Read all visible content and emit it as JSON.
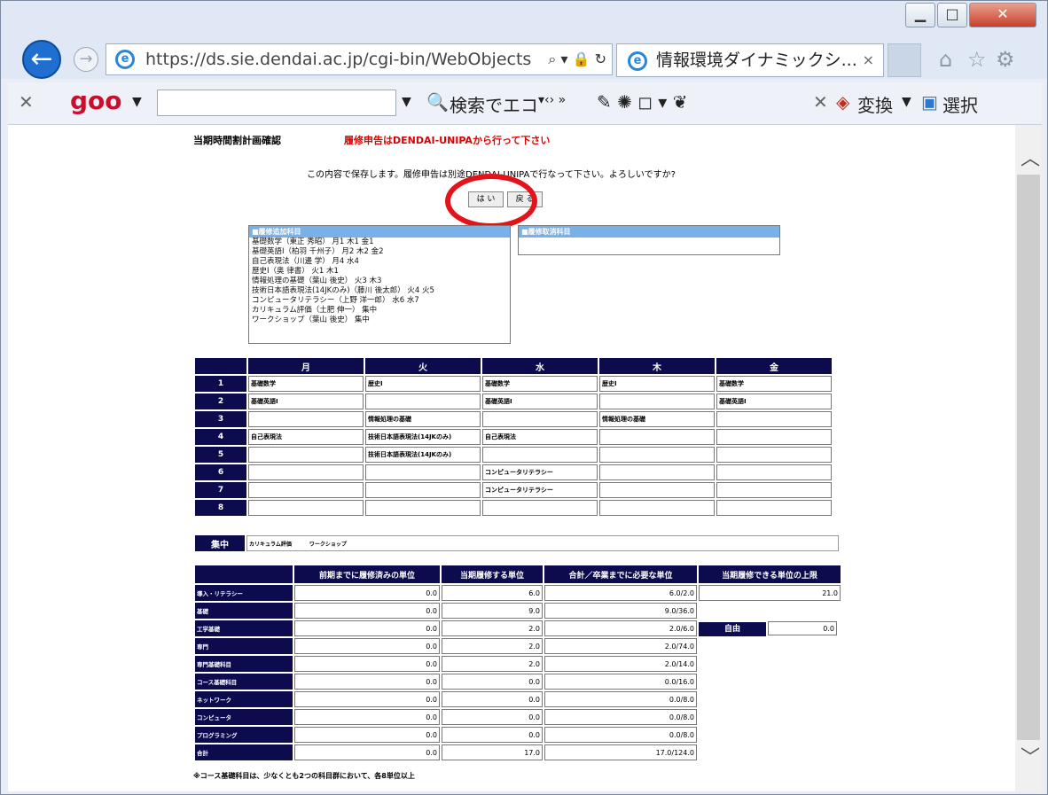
{
  "browser": {
    "url": "https://ds.sie.dendai.ac.jp/cgi-bin/WebObjects",
    "tab_title": "情報環境ダイナミックシ...",
    "toolbar": {
      "brand": "goo",
      "eco_search": "検索でエコ",
      "convert": "変換",
      "select": "選択"
    }
  },
  "page": {
    "title": "当期時間割計画確認",
    "notice": "履修申告はDENDAI-UNIPAから行って下さい",
    "confirm_message": "この内容で保存します。履修申告は別途DENDAI-UNIPAで行なって下さい。よろしいですか?",
    "yes_button": "は い",
    "cancel_button": "戻 る",
    "added_box": {
      "header": "■履修追加科目",
      "courses": [
        "基礎数学（東正 秀昭） 月1 木1 金1",
        "基礎英語Ⅰ（柏羽 千州子） 月2 木2 金2",
        "自己表現法（川邊 学） 月4 水4",
        "歴史Ⅰ（奥 律書） 火1 木1",
        "情報処理の基礎（葉山 後史） 火3 木3",
        "技術日本語表現法(14JKのみ)（藤川 後太郎） 火4 火5",
        "コンピュータリテラシー（上野 洋一郎） 水6 水7",
        "カリキュラム評価（土肥 伸一） 集中",
        "ワークショップ（葉山 後史） 集中"
      ]
    },
    "dropped_box": {
      "header": "■履修取消科目"
    },
    "timetable": {
      "days": [
        "月",
        "火",
        "水",
        "木",
        "金"
      ],
      "periods": [
        "1",
        "2",
        "3",
        "4",
        "5",
        "6",
        "7",
        "8"
      ],
      "rows": [
        [
          "基礎数学",
          "歴史Ⅰ",
          "基礎数学",
          "歴史Ⅰ",
          "基礎数学"
        ],
        [
          "基礎英語Ⅰ",
          "",
          "基礎英語Ⅰ",
          "",
          "基礎英語Ⅰ"
        ],
        [
          "",
          "情報処理の基礎",
          "",
          "情報処理の基礎",
          ""
        ],
        [
          "自己表現法",
          "技術日本語表現法(14JKのみ)",
          "自己表現法",
          "",
          ""
        ],
        [
          "",
          "技術日本語表現法(14JKのみ)",
          "",
          "",
          ""
        ],
        [
          "",
          "",
          "コンピュータリテラシー",
          "",
          ""
        ],
        [
          "",
          "",
          "コンピュータリテラシー",
          "",
          ""
        ],
        [
          "",
          "",
          "",
          "",
          ""
        ]
      ],
      "intensive_label": "集中",
      "intensive_courses": [
        "カリキュラム評価",
        "ワークショップ"
      ]
    },
    "credits": {
      "headers": [
        "前期までに履修済みの単位",
        "当期履修する単位",
        "合計／卒業までに必要な単位",
        "当期履修できる単位の上限"
      ],
      "rows": [
        {
          "label": "導入・リテラシー",
          "prev": "0.0",
          "curr": "6.0",
          "total": "6.0/2.0"
        },
        {
          "label": "基礎",
          "prev": "0.0",
          "curr": "9.0",
          "total": "9.0/36.0"
        },
        {
          "label": "工学基礎",
          "prev": "0.0",
          "curr": "2.0",
          "total": "2.0/6.0"
        },
        {
          "label": "専門",
          "prev": "0.0",
          "curr": "2.0",
          "total": "2.0/74.0"
        },
        {
          "label": "専門基礎科目",
          "prev": "0.0",
          "curr": "2.0",
          "total": "2.0/14.0"
        },
        {
          "label": "コース基礎科目",
          "prev": "0.0",
          "curr": "0.0",
          "total": "0.0/16.0"
        },
        {
          "label": "ネットワーク",
          "prev": "0.0",
          "curr": "0.0",
          "total": "0.0/8.0"
        },
        {
          "label": "コンピュータ",
          "prev": "0.0",
          "curr": "0.0",
          "total": "0.0/8.0"
        },
        {
          "label": "プログラミング",
          "prev": "0.0",
          "curr": "0.0",
          "total": "0.0/8.0"
        },
        {
          "label": "合計",
          "prev": "0.0",
          "curr": "17.0",
          "total": "17.0/124.0"
        }
      ],
      "upper_limit": "21.0",
      "free_label": "自由",
      "free_value": "0.0"
    },
    "footnote": "※コース基礎科目は、少なくとも2つの科目群において、各8単位以上"
  }
}
